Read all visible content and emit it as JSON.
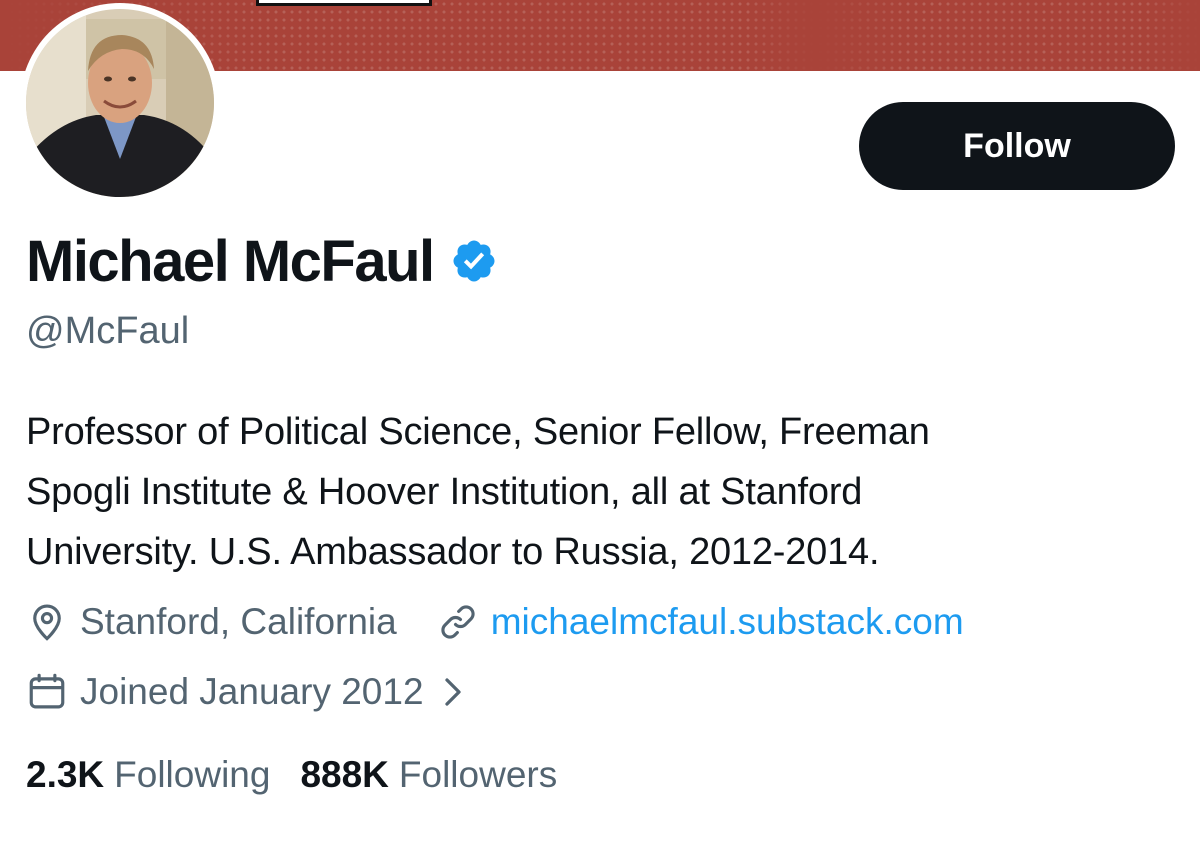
{
  "profile": {
    "display_name": "Michael McFaul",
    "handle": "@McFaul",
    "verified": true,
    "bio_lines": [
      "Professor of Political Science, Senior Fellow, Freeman",
      "Spogli Institute & Hoover Institution, all at Stanford",
      "University. U.S. Ambassador to Russia, 2012-2014."
    ],
    "location": "Stanford, California",
    "website": "michaelmcfaul.substack.com",
    "joined": "Joined January 2012",
    "following_count": "2.3K",
    "following_label": "Following",
    "followers_count": "888K",
    "followers_label": "Followers"
  },
  "actions": {
    "follow_label": "Follow"
  },
  "icons": {
    "verified": "verified-badge-icon",
    "location": "location-pin-icon",
    "link": "link-icon",
    "calendar": "calendar-icon",
    "chevron": "chevron-right-icon"
  },
  "colors": {
    "banner": "#a94339",
    "text_primary": "#0f1419",
    "text_secondary": "#536471",
    "link": "#1d9bf0",
    "button_bg": "#0f1419",
    "verified_blue": "#1d9bf0"
  }
}
